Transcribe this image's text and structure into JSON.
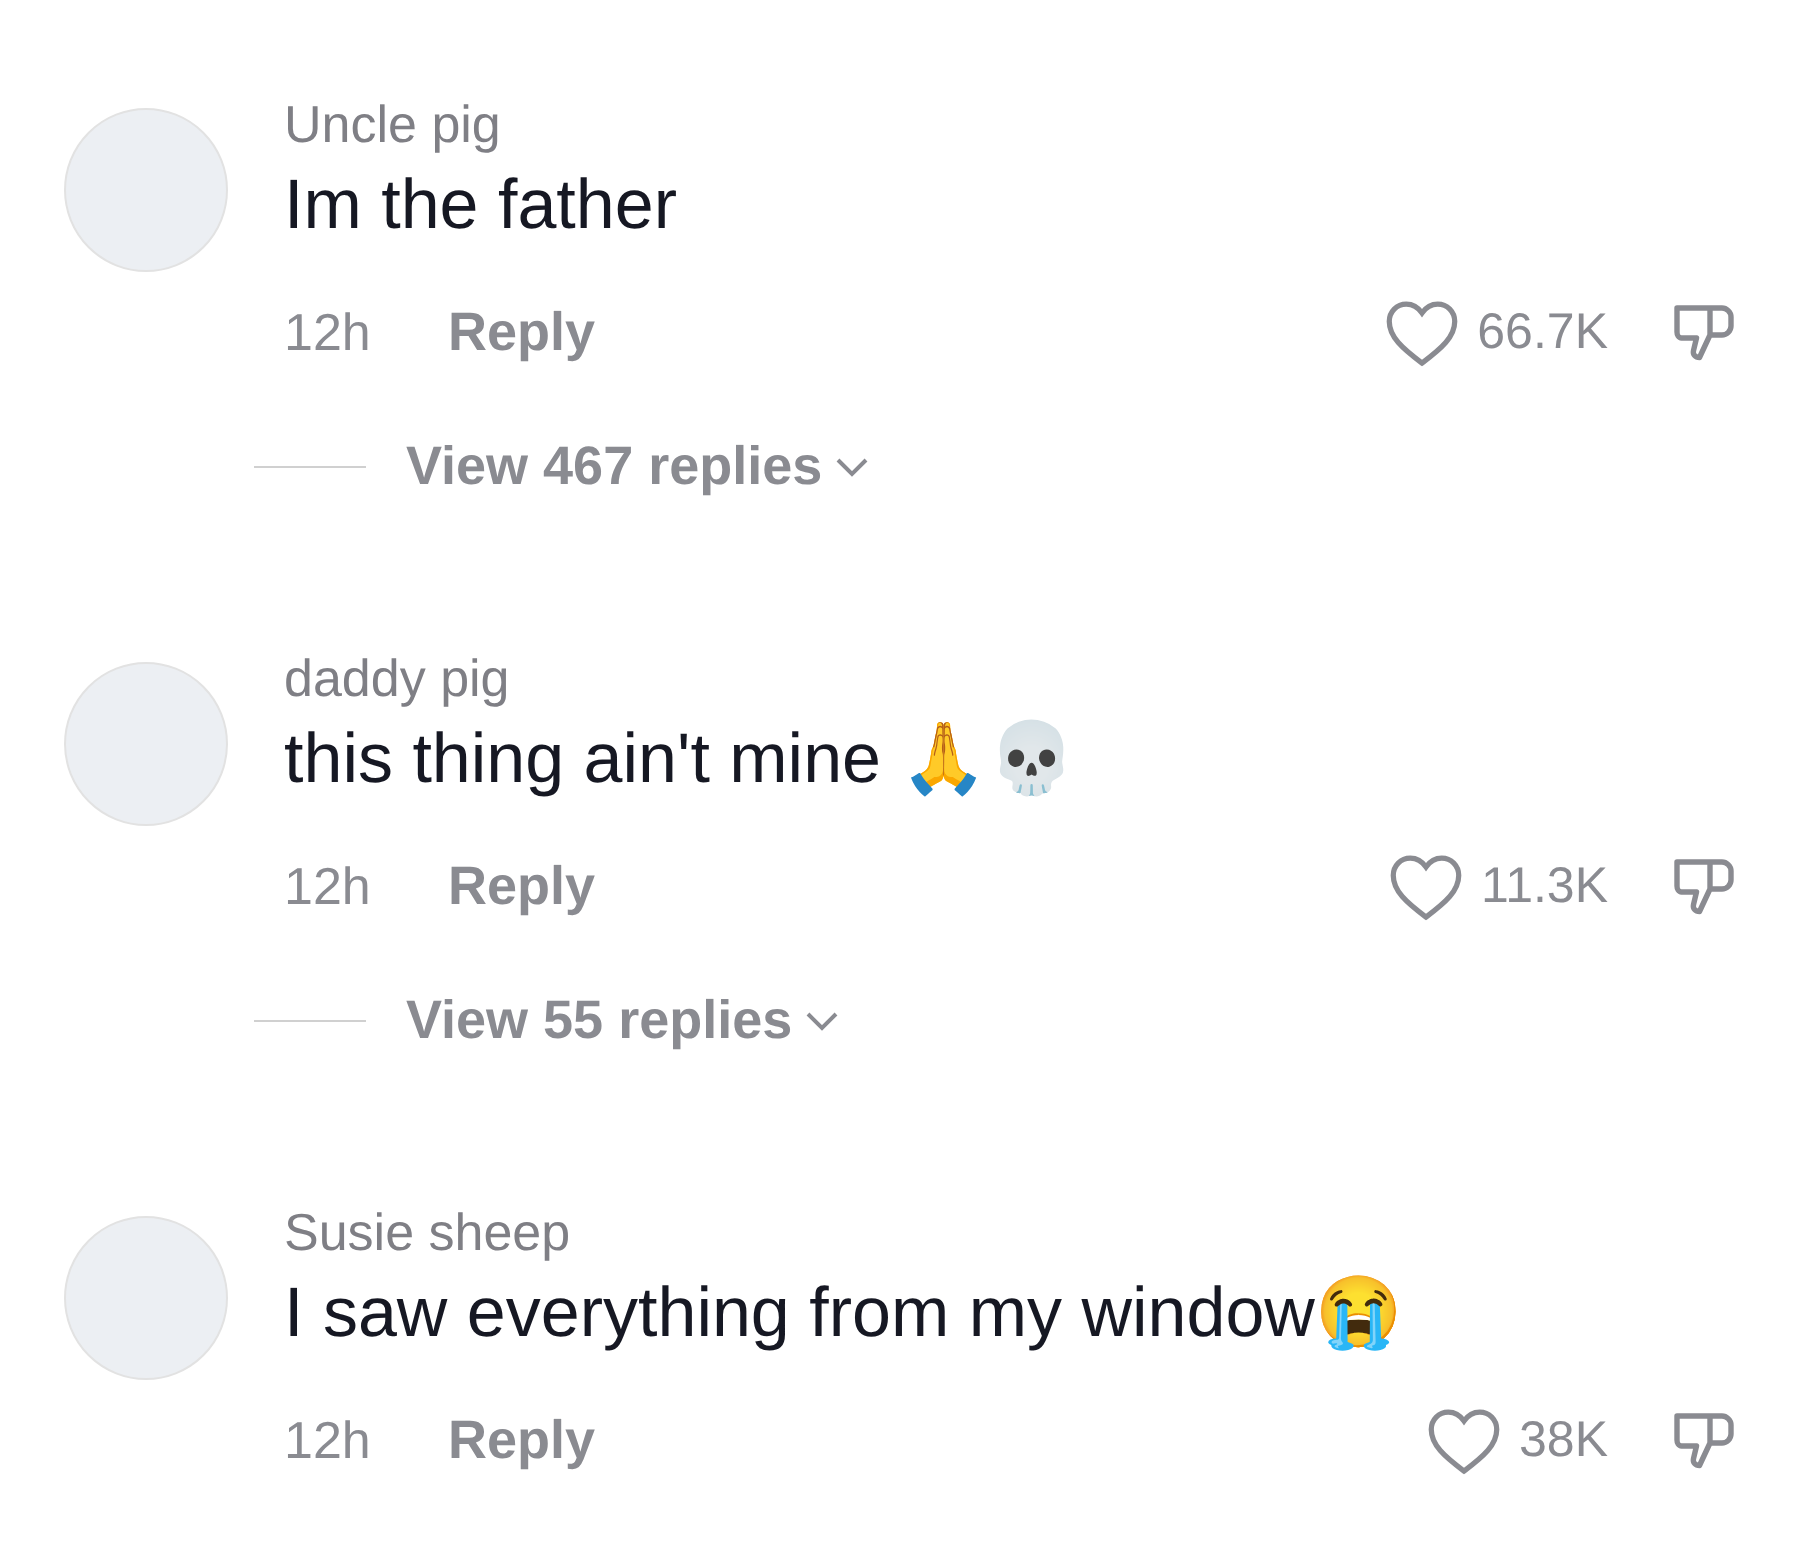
{
  "comments": [
    {
      "username": "Uncle pig",
      "text": "Im the father",
      "time": "12h",
      "reply": "Reply",
      "likes": "66.7K",
      "replies": "View 467 replies"
    },
    {
      "username": "daddy pig",
      "text": "this thing ain't mine 🙏💀",
      "time": "12h",
      "reply": "Reply",
      "likes": "11.3K",
      "replies": "View 55 replies"
    },
    {
      "username": "Susie sheep",
      "text": "I saw everything from my window😭",
      "time": "12h",
      "reply": "Reply",
      "likes": "38K"
    }
  ]
}
